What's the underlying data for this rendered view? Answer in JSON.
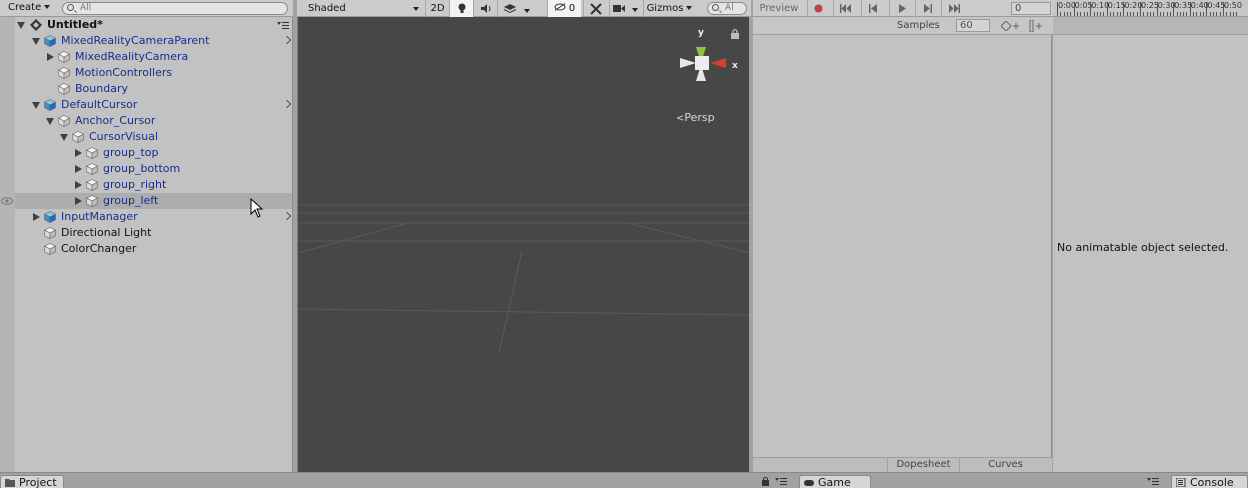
{
  "hierarchy": {
    "create_label": "Create",
    "search_placeholder": "All",
    "scene_title": "Untitled*",
    "items": [
      {
        "label": "MixedRealityCameraParent",
        "depth": 1,
        "expand": "open",
        "style": "prefab",
        "icon": "prefab-cube-icon",
        "chevron": true
      },
      {
        "label": "MixedRealityCamera",
        "depth": 2,
        "expand": "closed",
        "style": "prefab",
        "icon": "gameobject-cube-icon",
        "chevron": false
      },
      {
        "label": "MotionControllers",
        "depth": 2,
        "expand": "none",
        "style": "prefab",
        "icon": "gameobject-cube-icon",
        "chevron": false
      },
      {
        "label": "Boundary",
        "depth": 2,
        "expand": "none",
        "style": "prefab",
        "icon": "gameobject-cube-icon",
        "chevron": false
      },
      {
        "label": "DefaultCursor",
        "depth": 1,
        "expand": "open",
        "style": "prefab",
        "icon": "prefab-cube-icon",
        "chevron": true
      },
      {
        "label": "Anchor_Cursor",
        "depth": 2,
        "expand": "open",
        "style": "prefab",
        "icon": "gameobject-cube-icon",
        "chevron": false
      },
      {
        "label": "CursorVisual",
        "depth": 3,
        "expand": "open",
        "style": "prefab",
        "icon": "gameobject-cube-icon",
        "chevron": false
      },
      {
        "label": "group_top",
        "depth": 4,
        "expand": "closed",
        "style": "prefab",
        "icon": "gameobject-cube-icon",
        "chevron": false
      },
      {
        "label": "group_bottom",
        "depth": 4,
        "expand": "closed",
        "style": "prefab",
        "icon": "gameobject-cube-icon",
        "chevron": false
      },
      {
        "label": "group_right",
        "depth": 4,
        "expand": "closed",
        "style": "prefab",
        "icon": "gameobject-cube-icon",
        "chevron": false
      },
      {
        "label": "group_left",
        "depth": 4,
        "expand": "closed",
        "style": "prefab",
        "icon": "gameobject-cube-icon",
        "chevron": false,
        "selected": true
      },
      {
        "label": "InputManager",
        "depth": 1,
        "expand": "closed",
        "style": "prefab",
        "icon": "prefab-cube-icon",
        "chevron": true
      },
      {
        "label": "Directional Light",
        "depth": 1,
        "expand": "none",
        "style": "plain",
        "icon": "gameobject-cube-icon",
        "chevron": false
      },
      {
        "label": "ColorChanger",
        "depth": 1,
        "expand": "none",
        "style": "plain",
        "icon": "gameobject-cube-icon",
        "chevron": false
      }
    ]
  },
  "scene": {
    "shading_mode": "Shaded",
    "mode_2d": "2D",
    "hidden_count": "0",
    "gizmos_label": "Gizmos",
    "search_placeholder": "Al",
    "projection_label": "Persp",
    "axis_y": "y",
    "axis_x": "x",
    "colors": {
      "y_axis": "#8bc63f",
      "x_axis": "#d6402a",
      "background": "#474747"
    }
  },
  "animation": {
    "preview_label": "Preview",
    "frame_value": "0",
    "samples_label": "Samples",
    "samples_value": "60",
    "empty_message": "No animatable object selected.",
    "dopesheet_label": "Dopesheet",
    "curves_label": "Curves",
    "timeline_ticks": [
      "0:00",
      "0:05",
      "0:10",
      "0:15",
      "0:20",
      "0:25",
      "0:30",
      "0:35",
      "0:40",
      "0:45",
      "0:50"
    ]
  },
  "bottom_tabs": {
    "project": "Project",
    "game": "Game",
    "console": "Console"
  }
}
